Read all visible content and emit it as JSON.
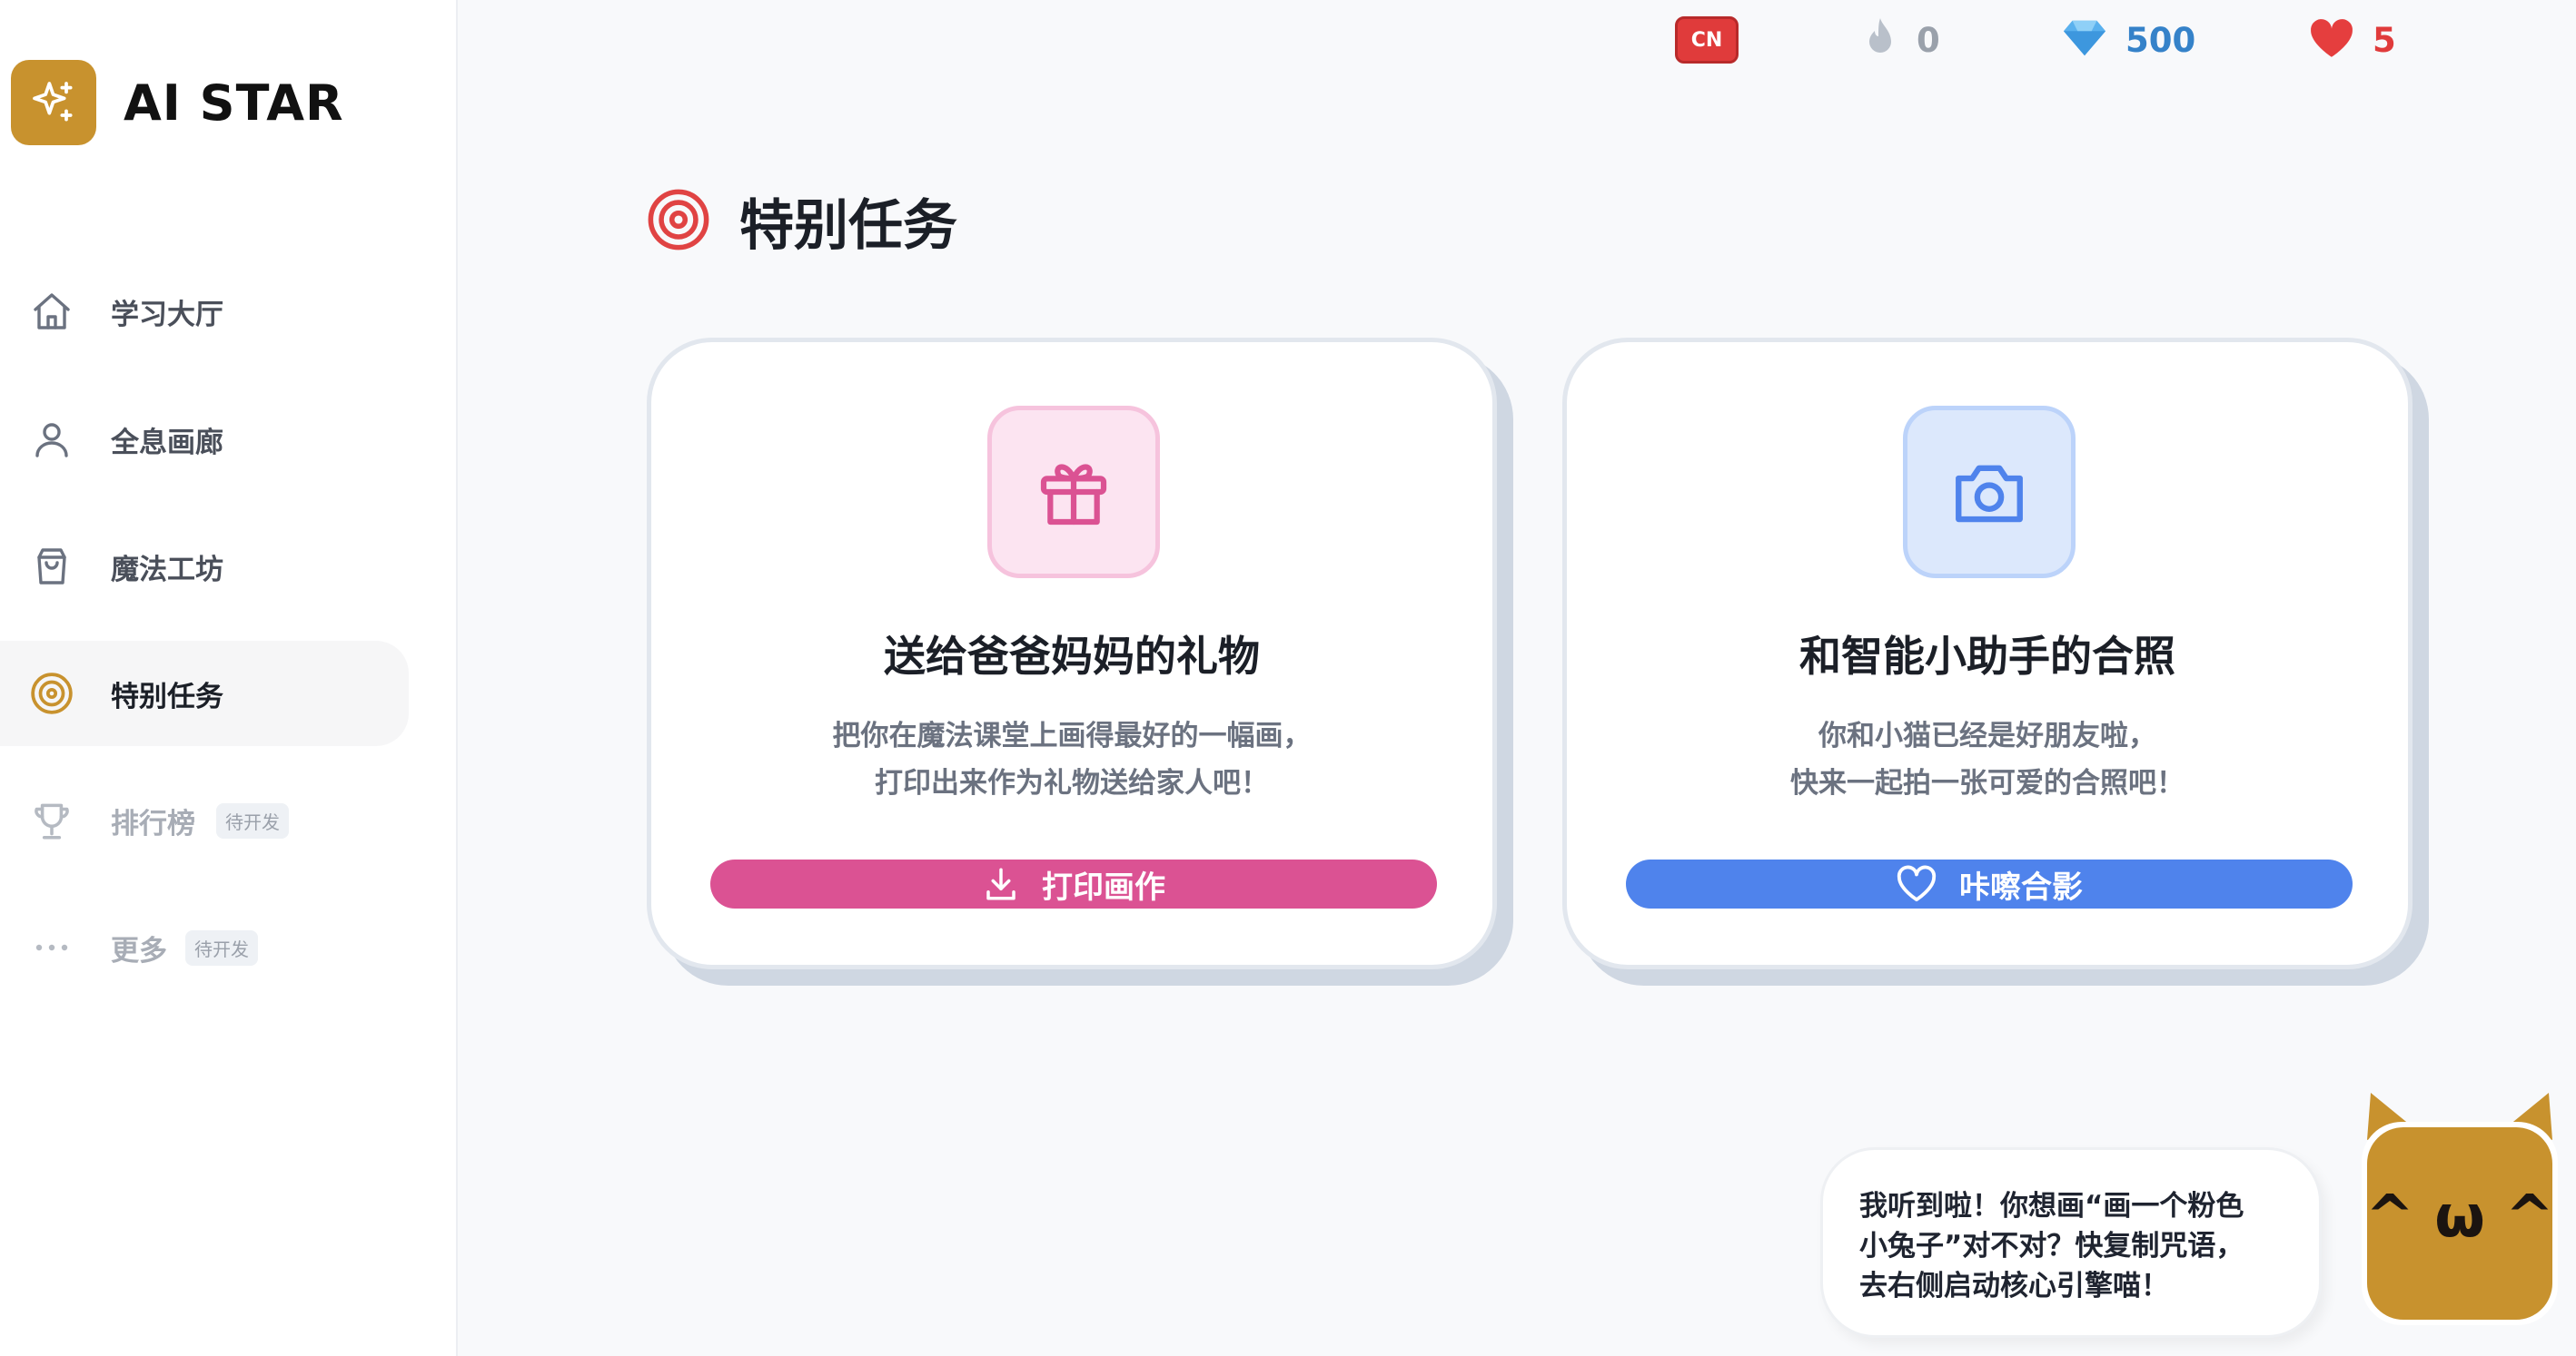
{
  "brand": {
    "name": "AI STAR"
  },
  "sidebar": {
    "items": [
      {
        "label": "学习大厅",
        "icon": "home-icon"
      },
      {
        "label": "全息画廊",
        "icon": "user-icon"
      },
      {
        "label": "魔法工坊",
        "icon": "shopping-bag-icon"
      },
      {
        "label": "特别任务",
        "icon": "target-icon",
        "active": true
      },
      {
        "label": "排行榜",
        "icon": "trophy-icon",
        "badge": "待开发"
      },
      {
        "label": "更多",
        "icon": "more-dots-icon",
        "badge": "待开发"
      }
    ]
  },
  "topbar": {
    "language": "CN",
    "streak": "0",
    "gems": "500",
    "hearts": "5"
  },
  "page": {
    "title": "特别任务"
  },
  "cards": [
    {
      "title": "送给爸爸妈妈的礼物",
      "desc_line1": "把你在魔法课堂上画得最好的一幅画，",
      "desc_line2": "打印出来作为礼物送给家人吧！",
      "button": "打印画作",
      "icon": "gift-icon",
      "accent": "#db5293"
    },
    {
      "title": "和智能小助手的合照",
      "desc_line1": "你和小猫已经是好朋友啦，",
      "desc_line2": "快来一起拍一张可爱的合照吧！",
      "button": "咔嚓合影",
      "icon": "camera-icon",
      "accent": "#4f83ec"
    }
  ],
  "assistant": {
    "message_line1": "我听到啦！你想画“画一个粉色",
    "message_line2": "小兔子”对不对？快复制咒语，",
    "message_line3": "去右侧启动核心引擎喵！",
    "face": "^ ω ^"
  },
  "colors": {
    "brand": "#c8922e",
    "danger": "#e03b3b",
    "gem": "#4fa3e8",
    "heart": "#e53e3e"
  }
}
